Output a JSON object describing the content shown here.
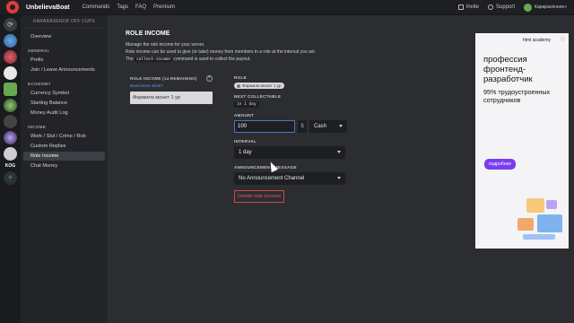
{
  "app": {
    "brand": "UnbelievaBoat"
  },
  "topnav": {
    "links": [
      "Commands",
      "Tags",
      "FAQ",
      "Premium"
    ]
  },
  "topright": {
    "invite": "Invite",
    "support": "Support",
    "user": "Карарасённое»"
  },
  "rail": {
    "guild_abbrev": "KOG",
    "add_symbol": "+"
  },
  "sidebar": {
    "guild_title": "KARARASENOK OFF CUPS",
    "overview": "Overview",
    "general_head": "GENERAL",
    "prefix": "Prefix",
    "join_leave": "Join / Leave Announcements",
    "economy_head": "ECONOMY",
    "currency_symbol": "Currency Symbol",
    "starting_balance": "Starting Balance",
    "money_audit_log": "Money Audit Log",
    "income_head": "INCOME",
    "work_slut": "Work / Slut / Crime / Rob",
    "custom_replies": "Custom Replies",
    "role_income": "Role Income",
    "chat_money": "Chat Money"
  },
  "main": {
    "title": "ROLE INCOME",
    "desc1": "Manage the role income for your server.",
    "desc2": "Role income can be used to give (or take) money from members in a role at the interval you set.",
    "desc3_pre": "The",
    "desc3_code": "collect-income",
    "desc3_post": "command is used to collect the payout."
  },
  "list": {
    "header": "ROLE INCOME (14 REMAINING)",
    "need_more": "Need More Slots?",
    "add": "+",
    "items": [
      "Фармила монет 1 ур"
    ]
  },
  "form": {
    "role_label": "ROLE",
    "role_value": "Фармила монет 1 ур",
    "next_label": "NEXT COLLECTABLE",
    "next_value": "in 1 day",
    "amount_label": "AMOUNT",
    "amount_value": "100",
    "currency_symbol": "$",
    "amount_type": "Cash",
    "interval_label": "INTERVAL",
    "interval_value": "1 day",
    "announce_label": "ANNOUNCEMENT MESSAGE",
    "announce_value": "No Announcement Channel",
    "delete_label": "Delete role income"
  },
  "ad": {
    "logo": "html academy",
    "mark": "ⓘ",
    "headline": "профессия фронтенд-разработчик",
    "subline": "95% трудоустроенных сотрудников",
    "button": "подробнее"
  }
}
